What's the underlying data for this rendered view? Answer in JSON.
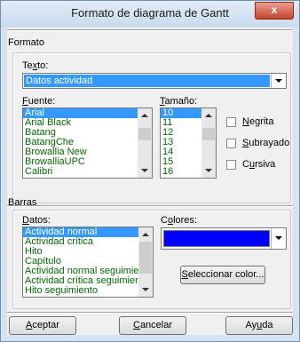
{
  "window": {
    "title": "Formato de diagrama de Gantt",
    "close_glyph": "x"
  },
  "formato": {
    "section_label": "Formato",
    "texto_label_pre": "Te",
    "texto_label_acc": "x",
    "texto_label_post": "to:",
    "texto_value": "Datos actividad",
    "fuente_label_acc": "F",
    "fuente_label_post": "uente:",
    "fonts": [
      "Arial",
      "Arial Black",
      "Batang",
      "BatangChe",
      "Browallia New",
      "BrowalliaUPC",
      "Calibri"
    ],
    "selected_font_index": 0,
    "tamano_label_acc": "T",
    "tamano_label_post": "amaño:",
    "sizes": [
      "10",
      "11",
      "12",
      "13",
      "14",
      "15",
      "16"
    ],
    "selected_size_index": 0,
    "negrita_acc": "N",
    "negrita_post": "egrita",
    "subrayado_acc": "S",
    "subrayado_post": "ubrayado",
    "cursiva_acc": "C",
    "cursiva_pre": "",
    "cursiva_label_a": "C",
    "cursiva_label_b": "u",
    "cursiva_label_c": "rsiva"
  },
  "barras": {
    "section_label": "Barras",
    "datos_label_acc": "D",
    "datos_label_post": "atos:",
    "items": [
      "Actividad normal",
      "Actividad crítica",
      "Hito",
      "Capítulo",
      "Actividad normal seguimient",
      "Actividad crítica seguimiento",
      "Hito seguimiento"
    ],
    "selected_index": 0,
    "colores_label_pre": "C",
    "colores_label_acc": "o",
    "colores_label_post": "lores:",
    "color_value": "#0000ff",
    "seleccionar_acc": "S",
    "seleccionar_post": "eleccionar color..."
  },
  "buttons": {
    "aceptar_acc": "A",
    "aceptar_post": "ceptar",
    "cancelar_acc": "C",
    "cancelar_post": "ancelar",
    "ayuda_pre": "Ay",
    "ayuda_acc": "u",
    "ayuda_post": "da"
  },
  "colors": {
    "selection": "#3399ff",
    "list_text": "#006a00",
    "close": "#c7422d"
  }
}
